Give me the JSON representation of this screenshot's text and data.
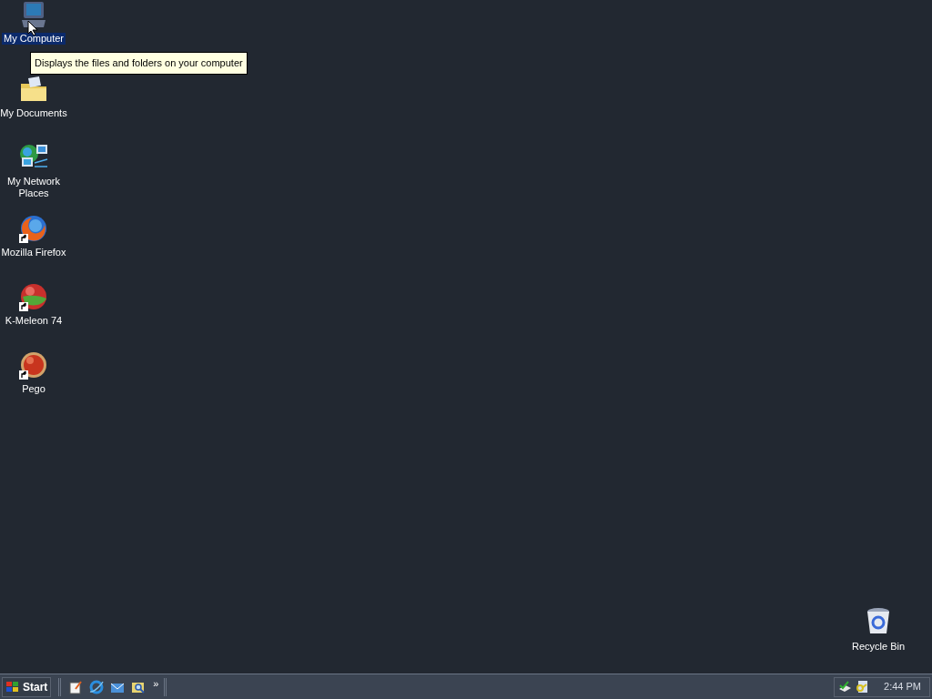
{
  "desktop_icons": [
    {
      "kind": "computer",
      "label": "My Computer",
      "selected": true,
      "shortcut": false
    },
    {
      "kind": "documents",
      "label": "My Documents",
      "selected": false,
      "shortcut": false
    },
    {
      "kind": "network",
      "label": "My Network Places",
      "selected": false,
      "shortcut": false
    },
    {
      "kind": "firefox",
      "label": "Mozilla Firefox",
      "selected": false,
      "shortcut": true
    },
    {
      "kind": "kmeleon",
      "label": "K-Meleon 74",
      "selected": false,
      "shortcut": true
    },
    {
      "kind": "pego",
      "label": "Pego",
      "selected": false,
      "shortcut": true
    }
  ],
  "tooltip": "Displays the files and folders on your computer",
  "recycle_bin": {
    "label": "Recycle Bin"
  },
  "taskbar": {
    "start": "Start",
    "quick_launch": [
      {
        "kind": "notepad"
      },
      {
        "kind": "browser"
      },
      {
        "kind": "mail"
      },
      {
        "kind": "search"
      }
    ],
    "chevron": "»",
    "tray": [
      {
        "kind": "network"
      },
      {
        "kind": "key"
      }
    ],
    "clock": "2:44 PM"
  }
}
